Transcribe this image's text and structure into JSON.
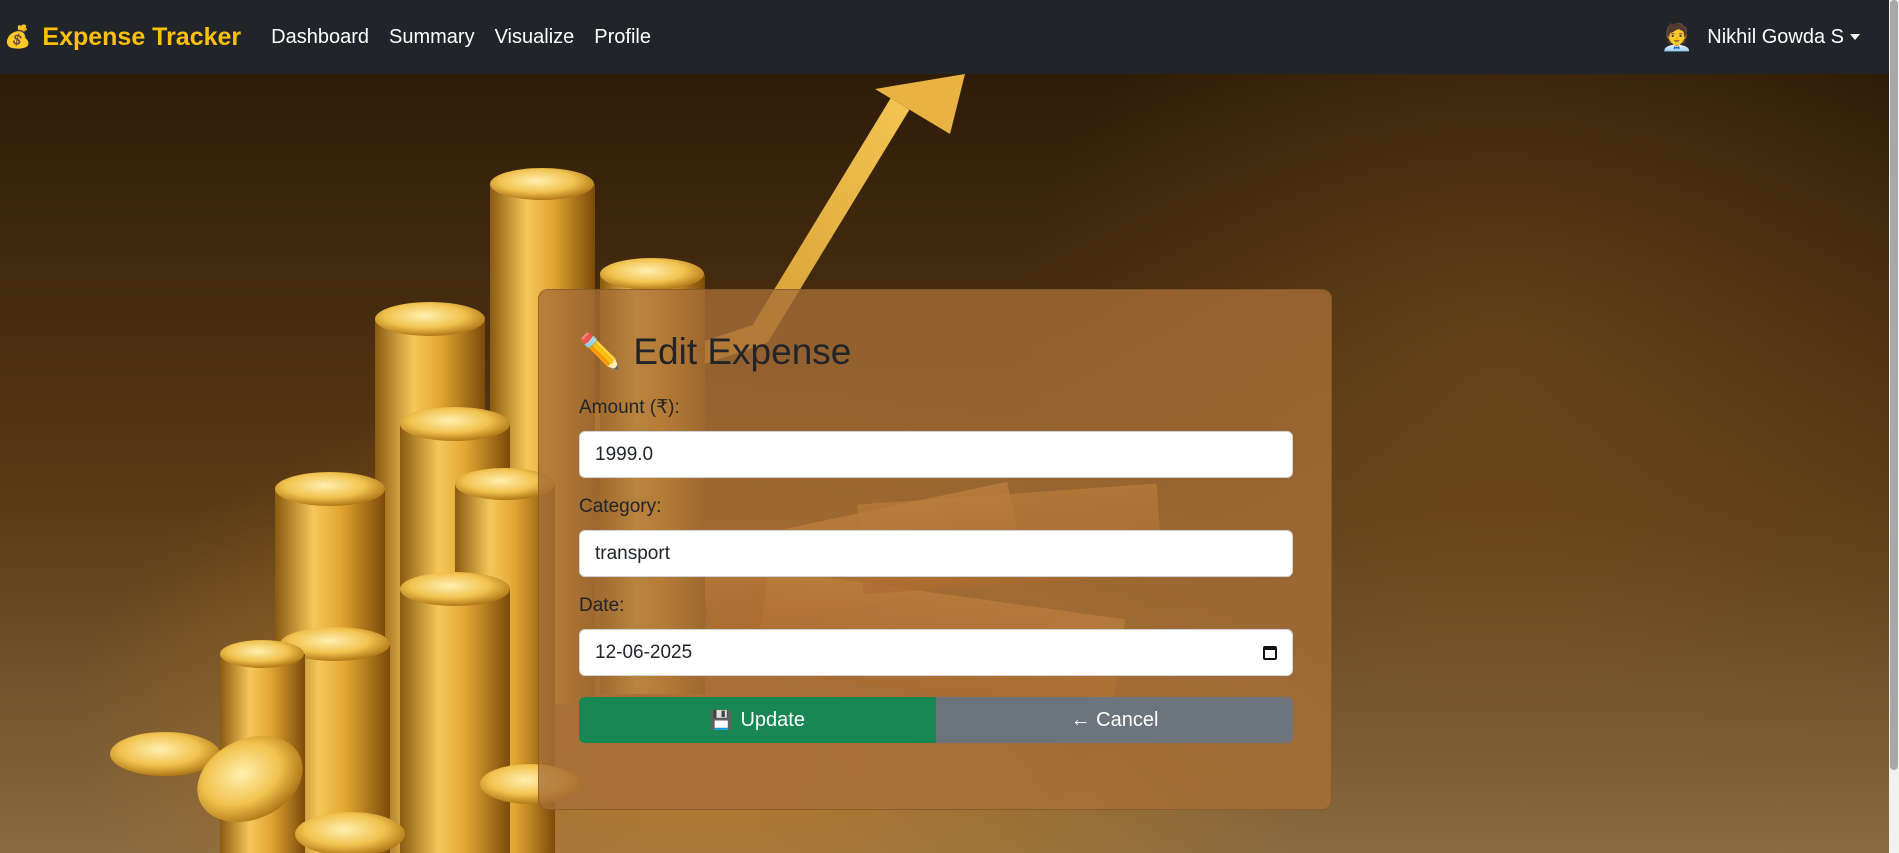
{
  "navbar": {
    "brand_icon": "money-bag-icon",
    "brand_glyph": "💰",
    "brand": "Expense Tracker",
    "links": [
      "Dashboard",
      "Summary",
      "Visualize",
      "Profile"
    ],
    "user_avatar": "person-with-sunglasses-icon",
    "user_avatar_glyph": "🧑‍💼",
    "user_name": "Nikhil Gowda S"
  },
  "form": {
    "title_icon": "pencil-icon",
    "title_glyph": "✏️",
    "title": "Edit Expense",
    "amount_label": "Amount (₹):",
    "amount_value": "1999.0",
    "category_label": "Category:",
    "category_value": "transport",
    "date_label": "Date:",
    "date_value": "12-06-2025",
    "update_icon": "floppy-disk-icon",
    "update_glyph": "💾",
    "update_label": "Update",
    "cancel_label": "← Cancel"
  },
  "colors": {
    "navbar_bg": "#212529",
    "brand": "#ffc107",
    "update_button": "#198754",
    "cancel_button": "#6c757d",
    "card": "#a87038"
  }
}
